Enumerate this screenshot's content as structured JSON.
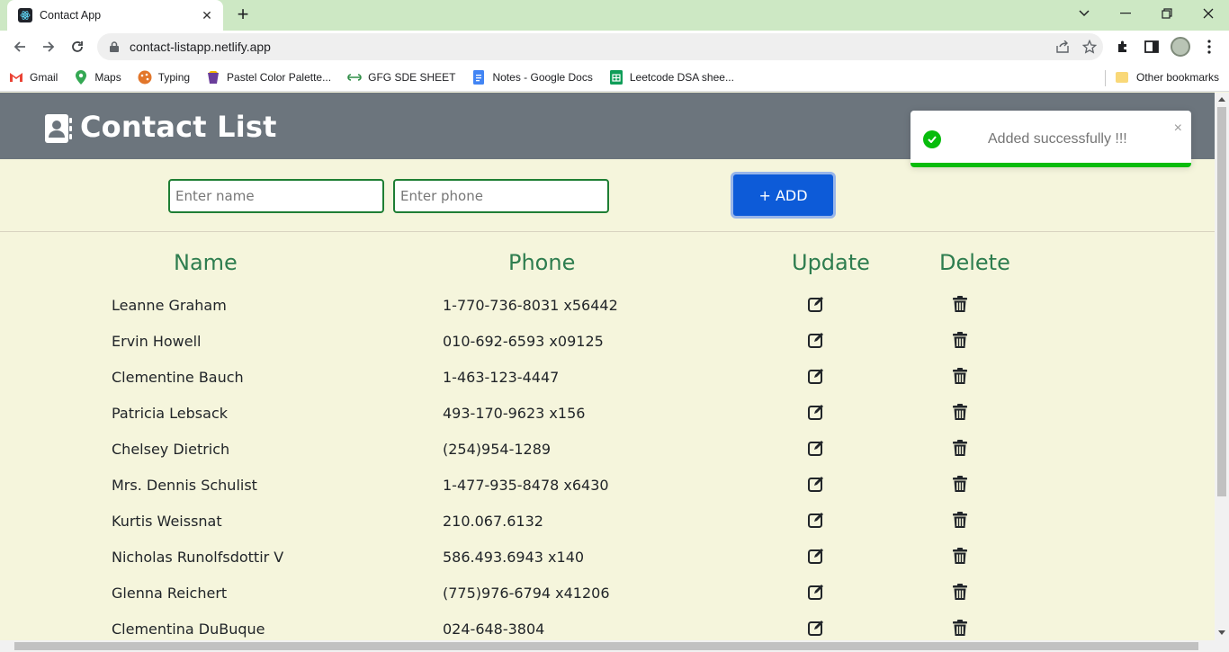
{
  "browser": {
    "tab_title": "Contact App",
    "url": "contact-listapp.netlify.app",
    "bookmarks": [
      {
        "label": "Gmail",
        "icon": "gmail-icon"
      },
      {
        "label": "Maps",
        "icon": "maps-icon"
      },
      {
        "label": "Typing",
        "icon": "typing-icon"
      },
      {
        "label": "Pastel Color Palette...",
        "icon": "palette-icon"
      },
      {
        "label": "GFG SDE SHEET",
        "icon": "gfg-icon"
      },
      {
        "label": "Notes - Google Docs",
        "icon": "docs-icon"
      },
      {
        "label": "Leetcode DSA shee...",
        "icon": "sheets-icon"
      }
    ],
    "other_bookmarks": "Other bookmarks"
  },
  "app": {
    "title": "Contact List",
    "name_placeholder": "Enter name",
    "phone_placeholder": "Enter phone",
    "add_label": "+ ADD"
  },
  "table": {
    "headers": {
      "name": "Name",
      "phone": "Phone",
      "update": "Update",
      "delete": "Delete"
    },
    "rows": [
      {
        "name": "Leanne Graham",
        "phone": "1-770-736-8031 x56442"
      },
      {
        "name": "Ervin Howell",
        "phone": "010-692-6593 x09125"
      },
      {
        "name": "Clementine Bauch",
        "phone": "1-463-123-4447"
      },
      {
        "name": "Patricia Lebsack",
        "phone": "493-170-9623 x156"
      },
      {
        "name": "Chelsey Dietrich",
        "phone": "(254)954-1289"
      },
      {
        "name": "Mrs. Dennis Schulist",
        "phone": "1-477-935-8478 x6430"
      },
      {
        "name": "Kurtis Weissnat",
        "phone": "210.067.6132"
      },
      {
        "name": "Nicholas Runolfsdottir V",
        "phone": "586.493.6943 x140"
      },
      {
        "name": "Glenna Reichert",
        "phone": "(775)976-6794 x41206"
      },
      {
        "name": "Clementina DuBuque",
        "phone": "024-648-3804"
      }
    ]
  },
  "toast": {
    "message": "Added successfully !!!",
    "close": "×"
  },
  "colors": {
    "header_bg": "#6c757d",
    "page_bg": "#f5f5dc",
    "accent_green": "#2e7d4f",
    "add_button": "#0d5bd8",
    "toast_success": "#07bc0c"
  }
}
